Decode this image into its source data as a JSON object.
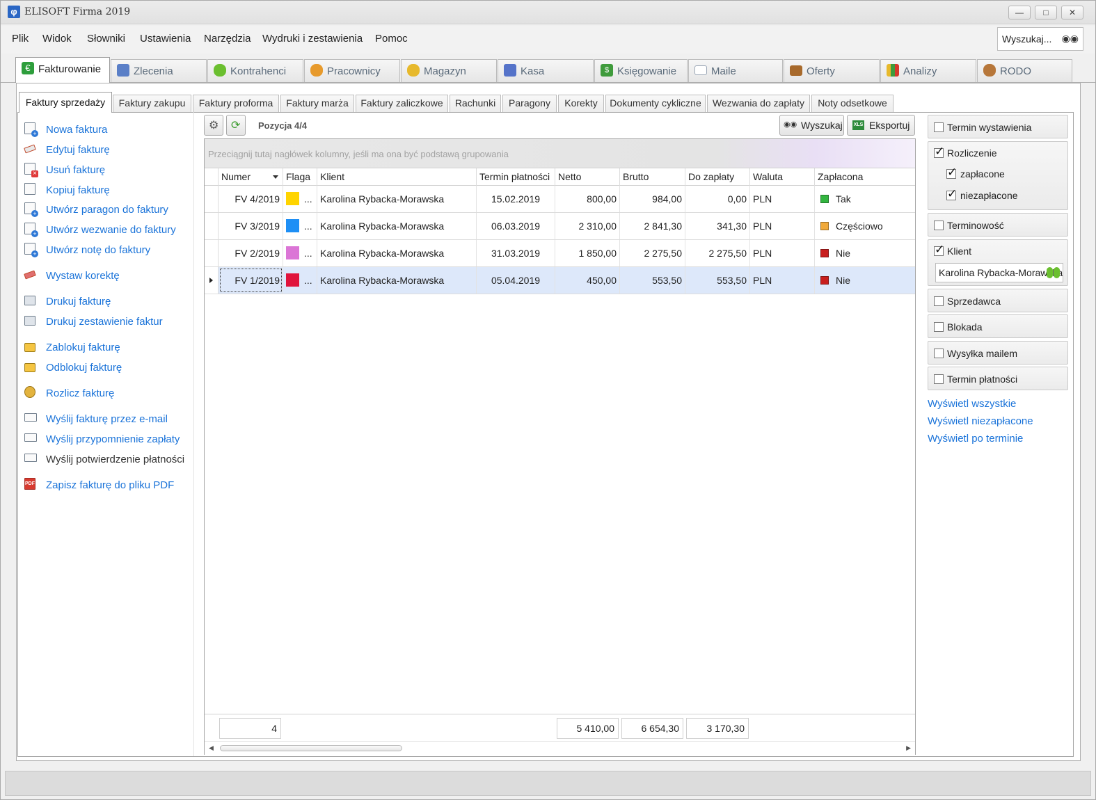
{
  "window": {
    "title": "ELISOFT Firma 2019",
    "icon_symbol": "φ"
  },
  "menu": {
    "items": [
      "Plik",
      "Widok",
      "Słowniki",
      "Ustawienia",
      "Narzędzia",
      "Wydruki i zestawienia",
      "Pomoc"
    ],
    "search_placeholder": "Wyszukaj..."
  },
  "modules": [
    {
      "label": "Fakturowanie",
      "icon": "euro-icon",
      "color": "#2e9e3c"
    },
    {
      "label": "Zlecenia",
      "icon": "documents-icon",
      "color": "#5a7fc7"
    },
    {
      "label": "Kontrahenci",
      "icon": "people-icon",
      "color": "#6bbf2f"
    },
    {
      "label": "Pracownicy",
      "icon": "workers-icon",
      "color": "#e79a2c"
    },
    {
      "label": "Magazyn",
      "icon": "bags-icon",
      "color": "#e7b92c"
    },
    {
      "label": "Kasa",
      "icon": "safe-icon",
      "color": "#5573c9"
    },
    {
      "label": "Księgowanie",
      "icon": "ledger-icon",
      "color": "#3f9b3c"
    },
    {
      "label": "Maile",
      "icon": "envelope-icon",
      "color": "#9aa6b5"
    },
    {
      "label": "Oferty",
      "icon": "briefcase-icon",
      "color": "#a86a2c"
    },
    {
      "label": "Analizy",
      "icon": "bar-chart-icon",
      "color": "#d6392b"
    },
    {
      "label": "RODO",
      "icon": "person-lock-icon",
      "color": "#b7773a"
    }
  ],
  "subtabs": [
    "Faktury sprzedaży",
    "Faktury zakupu",
    "Faktury proforma",
    "Faktury marża",
    "Faktury zaliczkowe",
    "Rachunki",
    "Paragony",
    "Korekty",
    "Dokumenty cykliczne",
    "Wezwania do zapłaty",
    "Noty odsetkowe"
  ],
  "actions": [
    {
      "label": "Nowa faktura",
      "icon": "new-invoice-icon"
    },
    {
      "label": "Edytuj fakturę",
      "icon": "edit-invoice-icon"
    },
    {
      "label": "Usuń fakturę",
      "icon": "delete-invoice-icon"
    },
    {
      "label": "Kopiuj fakturę",
      "icon": "copy-invoice-icon"
    },
    {
      "label": "Utwórz paragon do faktury",
      "icon": "create-receipt-icon"
    },
    {
      "label": "Utwórz wezwanie do faktury",
      "icon": "create-demand-icon"
    },
    {
      "label": "Utwórz notę do faktury",
      "icon": "create-note-icon"
    },
    {
      "label": "Wystaw korektę",
      "icon": "eraser-icon"
    },
    {
      "label": "Drukuj fakturę",
      "icon": "printer-icon"
    },
    {
      "label": "Drukuj zestawienie faktur",
      "icon": "printer-icon"
    },
    {
      "label": "Zablokuj fakturę",
      "icon": "lock-icon"
    },
    {
      "label": "Odblokuj fakturę",
      "icon": "unlock-icon"
    },
    {
      "label": "Rozlicz fakturę",
      "icon": "coins-icon"
    },
    {
      "label": "Wyślij fakturę przez e-mail",
      "icon": "mail-icon"
    },
    {
      "label": "Wyślij przypomnienie zapłaty",
      "icon": "mail-icon"
    },
    {
      "label": "Wyślij potwierdzenie płatności",
      "icon": "mail-icon"
    },
    {
      "label": "Zapisz fakturę do pliku PDF",
      "icon": "pdf-icon"
    }
  ],
  "toolbar": {
    "position_label": "Pozycja 4/4",
    "search_label": "Wyszukaj",
    "export_label": "Eksportuj"
  },
  "grid": {
    "group_hint": "Przeciągnij tutaj nagłówek kolumny, jeśli ma ona być podstawą grupowania",
    "columns": [
      "Numer",
      "Flaga",
      "Klient",
      "Termin płatności",
      "Netto",
      "Brutto",
      "Do zapłaty",
      "Waluta",
      "Zapłacona"
    ],
    "rows": [
      {
        "numer": "FV 4/2019",
        "flag_color": "#ffd400",
        "flag_dots": "...",
        "klient": "Karolina Rybacka-Morawska",
        "termin": "15.02.2019",
        "netto": "800,00",
        "brutto": "984,00",
        "do_zaplaty": "0,00",
        "waluta": "PLN",
        "paid_color": "#33b540",
        "zaplacona": "Tak"
      },
      {
        "numer": "FV 3/2019",
        "flag_color": "#1e8ff5",
        "flag_dots": "...",
        "klient": "Karolina Rybacka-Morawska",
        "termin": "06.03.2019",
        "netto": "2 310,00",
        "brutto": "2 841,30",
        "do_zaplaty": "341,30",
        "waluta": "PLN",
        "paid_color": "#f0a93a",
        "zaplacona": "Częściowo"
      },
      {
        "numer": "FV 2/2019",
        "flag_color": "#db75d6",
        "flag_dots": "...",
        "klient": "Karolina Rybacka-Morawska",
        "termin": "31.03.2019",
        "netto": "1 850,00",
        "brutto": "2 275,50",
        "do_zaplaty": "2 275,50",
        "waluta": "PLN",
        "paid_color": "#c81e1e",
        "zaplacona": "Nie"
      },
      {
        "numer": "FV 1/2019",
        "flag_color": "#e0143c",
        "flag_dots": "...",
        "klient": "Karolina Rybacka-Morawska",
        "termin": "05.04.2019",
        "netto": "450,00",
        "brutto": "553,50",
        "do_zaplaty": "553,50",
        "waluta": "PLN",
        "paid_color": "#c81e1e",
        "zaplacona": "Nie"
      }
    ],
    "totals": {
      "count": "4",
      "netto": "5 410,00",
      "brutto": "6 654,30",
      "do_zaplaty": "3 170,30"
    }
  },
  "filters": {
    "termin_wystawienia": {
      "label": "Termin wystawienia",
      "checked": false
    },
    "rozliczenie": {
      "label": "Rozliczenie",
      "checked": true,
      "opt_paid": "zapłacone",
      "opt_unpaid": "niezapłacone"
    },
    "terminowosc": {
      "label": "Terminowość",
      "checked": false
    },
    "klient": {
      "label": "Klient",
      "checked": true,
      "value": "Karolina Rybacka-Morawska"
    },
    "sprzedawca": {
      "label": "Sprzedawca",
      "checked": false
    },
    "blokada": {
      "label": "Blokada",
      "checked": false
    },
    "wysylka": {
      "label": "Wysyłka mailem",
      "checked": false
    },
    "termin_platnosci": {
      "label": "Termin płatności",
      "checked": false
    },
    "links": [
      "Wyświetl wszystkie",
      "Wyświetl niezapłacone",
      "Wyświetl po terminie"
    ]
  }
}
